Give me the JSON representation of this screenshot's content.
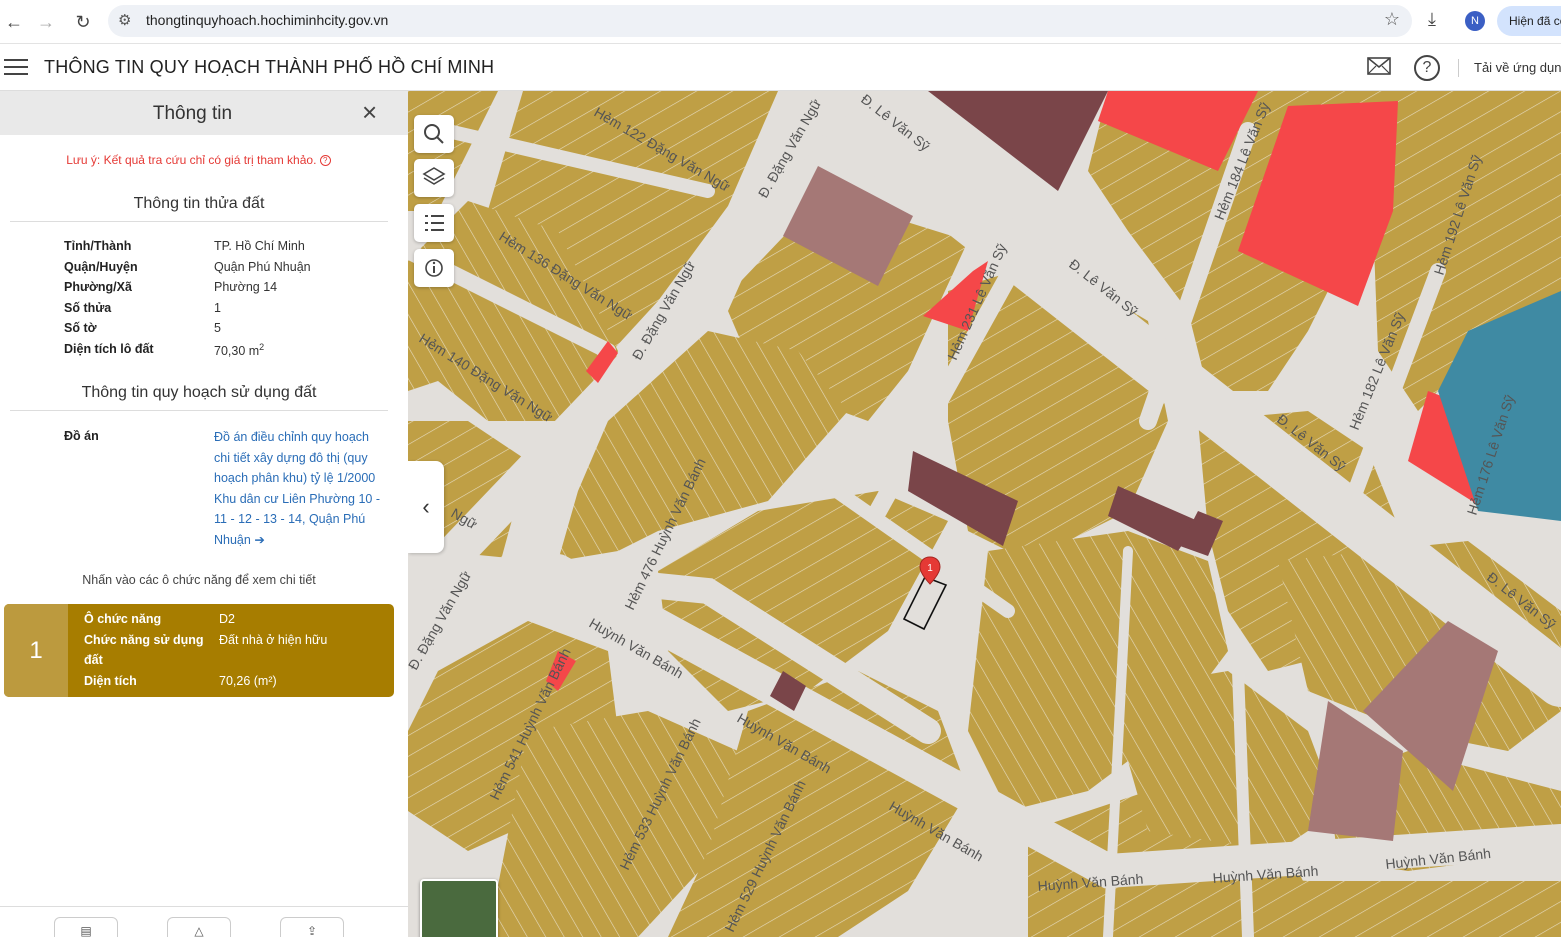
{
  "browser": {
    "url": "thongtinquyhoach.hochiminhcity.gov.vn",
    "avatar_initial": "N",
    "shown_label": "Hiện đã cc"
  },
  "app": {
    "title": "THÔNG TIN QUY HOẠCH THÀNH PHỐ HỒ CHÍ MINH",
    "help_label": "?",
    "get_app_label": "Tải về ứng dụng"
  },
  "panel": {
    "title": "Thông tin",
    "note": "Lưu ý: Kết quả tra cứu chỉ có giá trị tham khảo.",
    "parcel_section": "Thông tin thửa đất",
    "parcel": [
      {
        "key": "Tỉnh/Thành",
        "value": "TP. Hồ Chí Minh"
      },
      {
        "key": "Quận/Huyện",
        "value": "Quận Phú Nhuận"
      },
      {
        "key": "Phường/Xã",
        "value": "Phường 14"
      },
      {
        "key": "Số thửa",
        "value": "1"
      },
      {
        "key": "Số tờ",
        "value": "5"
      },
      {
        "key": "Diện tích lô đất",
        "value": "70,30 m",
        "unit_sup": "2"
      }
    ],
    "plan_section": "Thông tin quy hoạch sử dụng đất",
    "plan_key": "Đồ án",
    "plan_value": "Đồ án điều chỉnh quy hoạch chi tiết xây dựng đô thị (quy hoạch phân khu) tỷ lệ 1/2000 Khu dân cư Liên Phường 10 - 11 - 12 - 13 - 14, Quận Phú Nhuận",
    "hint": "Nhấn vào các ô chức năng để xem chi tiết",
    "function_card": {
      "number": "1",
      "rows": [
        {
          "key": "Ô chức năng",
          "value": "D2"
        },
        {
          "key": "Chức năng sử dụng đất",
          "value": "Đất nhà ở hiện hữu"
        },
        {
          "key": "Diện tích",
          "value": "70,26 (m²)"
        }
      ]
    }
  },
  "map": {
    "marker_label": "1",
    "streets": [
      "Hẻm 122 Đặng Văn Ngữ",
      "Đ. Đặng Văn Ngữ",
      "Đ. Lê Văn Sỹ",
      "Hẻm 136 Đặng Văn Ngữ",
      "Hẻm 184 Lê Văn Sỹ",
      "Hẻm 192 Lê Văn Sỹ",
      "Đ. Lê Văn Sỹ",
      "Hẻm 231 Lê Văn Sỹ",
      "Hẻm 140 Đặng Văn Ngữ",
      "Đ. Đặng Văn Ngữ",
      "Đ. Lê Văn Sỹ",
      "Hẻm 182 Lê Văn Sỹ",
      "Hẻm 476 Huỳnh Văn Bánh",
      "Hẻm 176 Lê Văn Sỹ",
      "Đ. Lê Văn Sỹ",
      "Đ. Đặng Văn Ngữ",
      "Huỳnh Văn Bánh",
      "Hẻm 541 Huỳnh Văn Bánh",
      "Huỳnh Văn Bánh",
      "Hẻm 533 Huỳnh Văn Bánh",
      "Huỳnh Văn Bánh",
      "Hẻm 529 Huỳnh Văn Bánh",
      "Huỳnh Văn Bánh",
      "Huỳnh Văn Bánh",
      "Huỳnh Văn Bánh",
      "Ngữ"
    ],
    "colors": {
      "residential": "#bf9f45",
      "commercial": "#f54749",
      "public": "#a57876",
      "mixed": "#7a4549",
      "water": "#3f8aa3",
      "road": "#e2dfdb"
    }
  }
}
